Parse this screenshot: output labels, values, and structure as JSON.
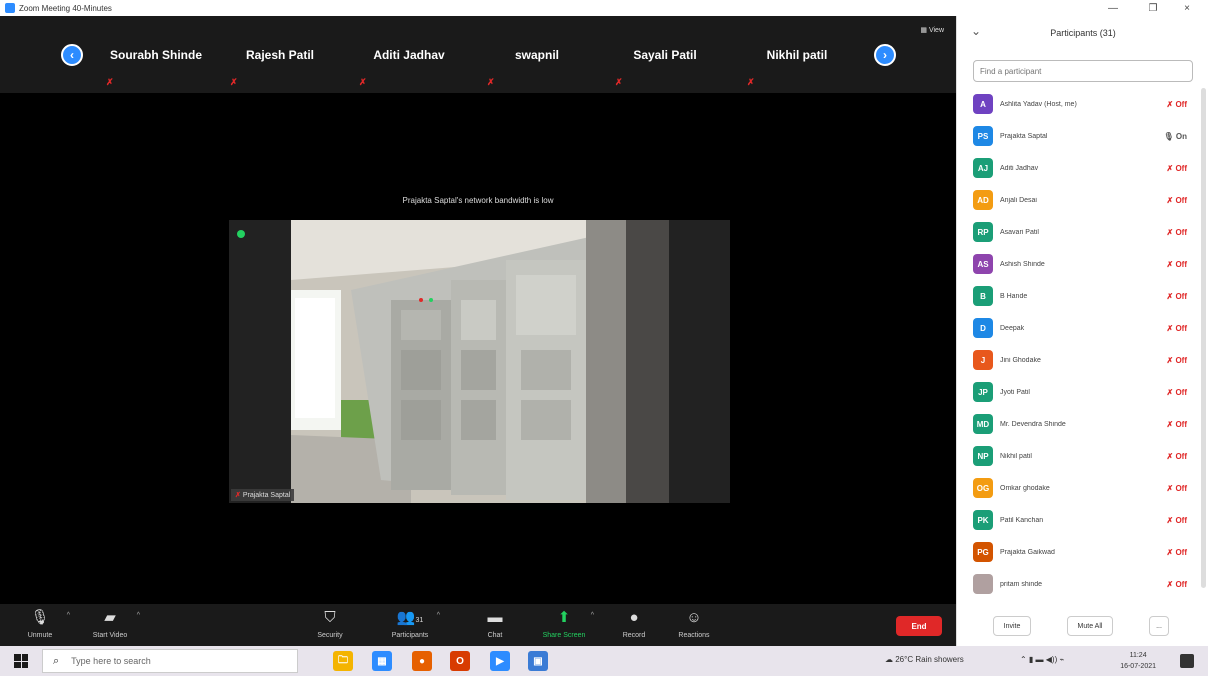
{
  "window": {
    "title": "Zoom Meeting 40-Minutes",
    "minimize": "—",
    "maximize": "❐",
    "close": "×"
  },
  "strip": {
    "prev_icon": "chevron-left-icon",
    "next_icon": "chevron-right-icon",
    "view_label": "View",
    "tiles": [
      {
        "name": "Sourabh Shinde"
      },
      {
        "name": "Rajesh Patil"
      },
      {
        "name": "Aditi Jadhav"
      },
      {
        "name": "swapnil"
      },
      {
        "name": "Sayali Patil"
      },
      {
        "name": "Nikhil patil"
      }
    ]
  },
  "main": {
    "banner": "Prajakta Saptal's network bandwidth is low",
    "speaker_name": "Prajakta Saptal"
  },
  "toolbar": {
    "unmute": "Unmute",
    "start_video": "Start Video",
    "security": "Security",
    "participants": "Participants",
    "participants_count": "31",
    "chat": "Chat",
    "share_screen": "Share Screen",
    "record": "Record",
    "reactions": "Reactions",
    "end": "End"
  },
  "panel": {
    "title": "Participants (31)",
    "search_placeholder": "Find a participant",
    "participants": [
      {
        "initials": "A",
        "name": "Ashlita Yadav (Host, me)",
        "color": "#6f42c1",
        "mic": "muted"
      },
      {
        "initials": "PS",
        "name": "Prajakta Saptal",
        "color": "#1e88e5",
        "mic": "on"
      },
      {
        "initials": "AJ",
        "name": "Aditi Jadhav",
        "color": "#1b9e77",
        "mic": "muted"
      },
      {
        "initials": "AD",
        "name": "Anjali Desai",
        "color": "#f39c12",
        "mic": "muted"
      },
      {
        "initials": "RP",
        "name": "Asavari Patil",
        "color": "#1b9e77",
        "mic": "muted"
      },
      {
        "initials": "AS",
        "name": "Ashish Shinde",
        "color": "#8e44ad",
        "mic": "muted"
      },
      {
        "initials": "B",
        "name": "B Hande",
        "color": "#1b9e77",
        "mic": "muted"
      },
      {
        "initials": "D",
        "name": "Deepak",
        "color": "#1e88e5",
        "mic": "muted"
      },
      {
        "initials": "J",
        "name": "Jini Ghodake",
        "color": "#e8581c",
        "mic": "muted"
      },
      {
        "initials": "JP",
        "name": "Jyoti Patil",
        "color": "#1b9e77",
        "mic": "muted"
      },
      {
        "initials": "MD",
        "name": "Mr. Devendra Shinde",
        "color": "#1b9e77",
        "mic": "muted"
      },
      {
        "initials": "NP",
        "name": "Nikhil patil",
        "color": "#1b9e77",
        "mic": "muted"
      },
      {
        "initials": "OG",
        "name": "Omkar ghodake",
        "color": "#f39c12",
        "mic": "muted"
      },
      {
        "initials": "PK",
        "name": "Patil Kanchan",
        "color": "#1b9e77",
        "mic": "muted"
      },
      {
        "initials": "PG",
        "name": "Prajakta Gaikwad",
        "color": "#d35400",
        "mic": "muted"
      },
      {
        "initials": "",
        "name": "pritam shinde",
        "color": "#b0a0a0",
        "mic": "muted"
      }
    ],
    "mic_muted_label": "Off",
    "mic_on_label": "On",
    "invite": "Invite",
    "mute_all": "Mute All",
    "more": "..."
  },
  "taskbar": {
    "search_placeholder": "Type here to search",
    "weather": "26°C  Rain showers",
    "time": "11:24",
    "date": "16-07-2021",
    "apps": [
      {
        "name": "file-explorer-icon",
        "glyph": "🗀",
        "color": "#f4b400"
      },
      {
        "name": "store-icon",
        "glyph": "▦",
        "color": "#2d8cff"
      },
      {
        "name": "firefox-icon",
        "glyph": "●",
        "color": "#e66000"
      },
      {
        "name": "office-icon",
        "glyph": "O",
        "color": "#d83b01"
      },
      {
        "name": "zoom-icon",
        "glyph": "▶",
        "color": "#2d8cff"
      },
      {
        "name": "photos-icon",
        "glyph": "▣",
        "color": "#3a7bd5"
      }
    ]
  }
}
